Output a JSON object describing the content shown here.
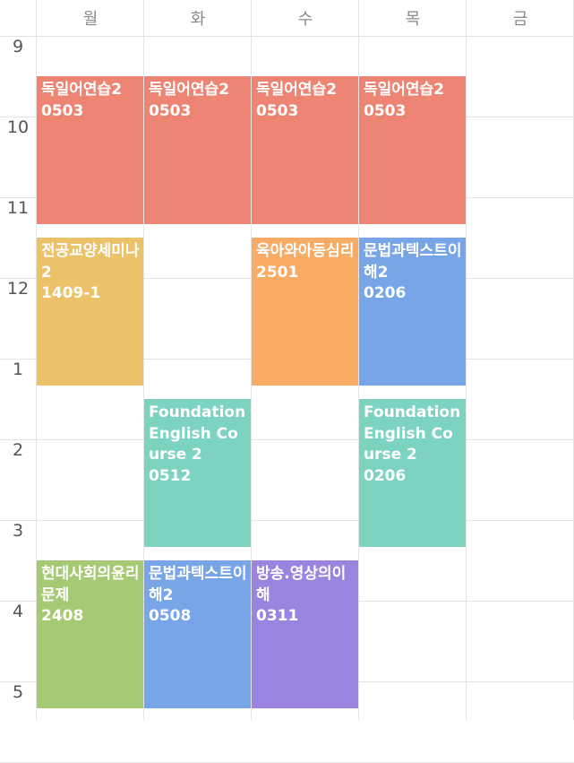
{
  "days": [
    "월",
    "화",
    "수",
    "목",
    "금"
  ],
  "hours": [
    "9",
    "10",
    "11",
    "12",
    "1",
    "2",
    "3",
    "4",
    "5"
  ],
  "colors": {
    "red": "#ee8474",
    "yellow": "#ecc268",
    "orange": "#f8ab65",
    "blue": "#78a5e8",
    "teal": "#7cd3c2",
    "green": "#a6c974",
    "purple": "#9a84df"
  },
  "events": [
    {
      "day": 0,
      "start": 9.5,
      "end": 11.33,
      "title": "독일어연습2",
      "room": "0503",
      "color": "red"
    },
    {
      "day": 1,
      "start": 9.5,
      "end": 11.33,
      "title": "독일어연습2",
      "room": "0503",
      "color": "red"
    },
    {
      "day": 2,
      "start": 9.5,
      "end": 11.33,
      "title": "독일어연습2",
      "room": "0503",
      "color": "red"
    },
    {
      "day": 3,
      "start": 9.5,
      "end": 11.33,
      "title": "독일어연습2",
      "room": "0503",
      "color": "red"
    },
    {
      "day": 0,
      "start": 11.5,
      "end": 13.33,
      "title": "전공교양세미나2",
      "room": "1409-1",
      "color": "yellow"
    },
    {
      "day": 2,
      "start": 11.5,
      "end": 13.33,
      "title": "육아와아동심리",
      "room": "2501",
      "color": "orange"
    },
    {
      "day": 3,
      "start": 11.5,
      "end": 13.33,
      "title": "문법과텍스트이해2",
      "room": "0206",
      "color": "blue"
    },
    {
      "day": 1,
      "start": 13.5,
      "end": 15.33,
      "title": "Foundation English Course 2",
      "room": "0512",
      "color": "teal"
    },
    {
      "day": 3,
      "start": 13.5,
      "end": 15.33,
      "title": "Foundation English Course 2",
      "room": "0206",
      "color": "teal"
    },
    {
      "day": 0,
      "start": 15.5,
      "end": 17.33,
      "title": "현대사회의윤리문제",
      "room": "2408",
      "color": "green"
    },
    {
      "day": 1,
      "start": 15.5,
      "end": 17.33,
      "title": "문법과텍스트이해2",
      "room": "0508",
      "color": "blue"
    },
    {
      "day": 2,
      "start": 15.5,
      "end": 17.33,
      "title": "방송.영상의이해",
      "room": "0311",
      "color": "purple"
    }
  ]
}
